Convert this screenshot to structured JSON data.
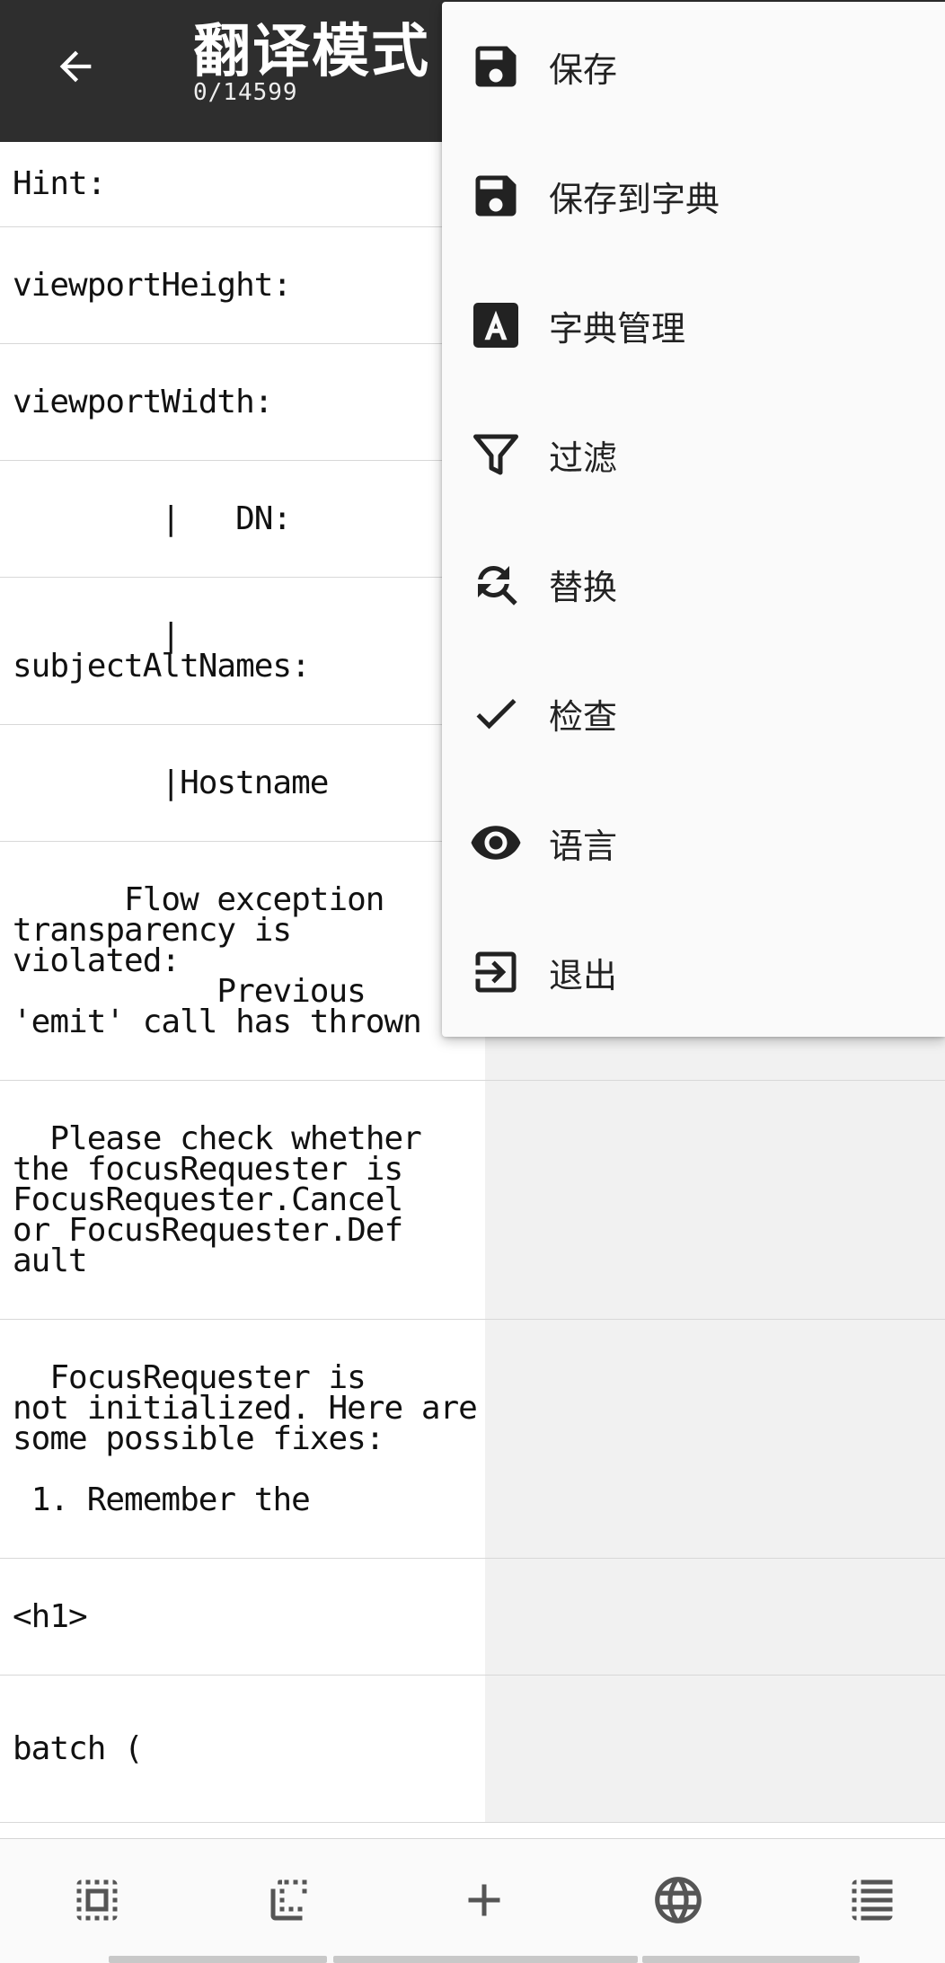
{
  "appbar": {
    "title": "翻译模式",
    "subtitle": "0/14599",
    "back_icon": "arrow-left-icon",
    "background": "#2e2e2e"
  },
  "rows": [
    {
      "source": "Hint:",
      "translation": ""
    },
    {
      "source": "viewportHeight:",
      "translation": ""
    },
    {
      "source": "viewportWidth:",
      "translation": ""
    },
    {
      "source": "        |   DN:",
      "translation": ""
    },
    {
      "source": "        |\nsubjectAltNames:",
      "translation": ""
    },
    {
      "source": "        |Hostname",
      "translation": ""
    },
    {
      "source": "      Flow exception\ntransparency is\nviolated:\n           Previous\n'emit' call has thrown",
      "translation": ""
    },
    {
      "source": "  Please check whether\nthe focusRequester is\nFocusRequester.Cancel\nor FocusRequester.Def\nault",
      "translation": ""
    },
    {
      "source": "  FocusRequester is\nnot initialized. Here are\nsome possible fixes:\n\n 1. Remember the",
      "translation": ""
    },
    {
      "source": "<h1>",
      "translation": ""
    },
    {
      "source": "batch (",
      "translation": ""
    }
  ],
  "menu": {
    "items": [
      {
        "label": "保存",
        "icon": "save-icon"
      },
      {
        "label": "保存到字典",
        "icon": "save-to-dictionary-icon"
      },
      {
        "label": "字典管理",
        "icon": "dictionary-icon"
      },
      {
        "label": "过滤",
        "icon": "filter-icon"
      },
      {
        "label": "替换",
        "icon": "find-replace-icon"
      },
      {
        "label": "检查",
        "icon": "check-icon"
      },
      {
        "label": "语言",
        "icon": "eye-icon"
      },
      {
        "label": "退出",
        "icon": "exit-icon"
      }
    ]
  },
  "bottombar": {
    "buttons": [
      {
        "icon": "select-all-icon"
      },
      {
        "icon": "deselect-icon"
      },
      {
        "icon": "add-icon"
      },
      {
        "icon": "globe-icon"
      },
      {
        "icon": "list-icon"
      }
    ]
  }
}
